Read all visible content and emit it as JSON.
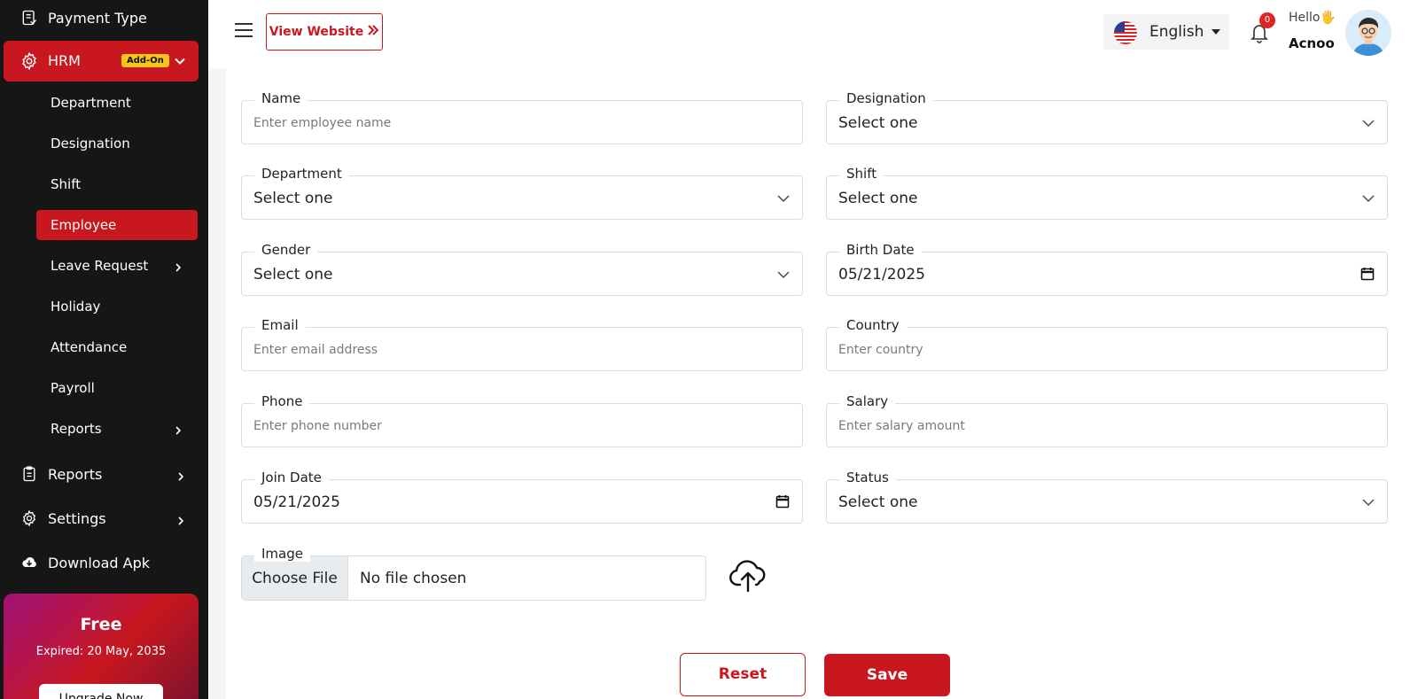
{
  "sidebar": {
    "top_item": "Payment Type",
    "hrm_label": "HRM",
    "hrm_badge": "Add-On",
    "sub_items": [
      {
        "label": "Department"
      },
      {
        "label": "Designation"
      },
      {
        "label": "Shift"
      },
      {
        "label": "Employee"
      },
      {
        "label": "Leave Request"
      },
      {
        "label": "Holiday"
      },
      {
        "label": "Attendance"
      },
      {
        "label": "Payroll"
      },
      {
        "label": "Reports"
      }
    ],
    "bottom_items": [
      {
        "label": "Reports"
      },
      {
        "label": "Settings"
      },
      {
        "label": "Download Apk"
      }
    ],
    "promo": {
      "plan": "Free",
      "expires": "Expired: 20 May, 2035",
      "button": "Upgrade Now"
    }
  },
  "header": {
    "view_website": "View Website",
    "language": "English",
    "notification_count": "0",
    "greeting": "Hello",
    "greeting_emoji": "🖐",
    "user_name": "Acnoo"
  },
  "form": {
    "name": {
      "label": "Name",
      "placeholder": "Enter employee name"
    },
    "designation": {
      "label": "Designation",
      "value": "Select one"
    },
    "department": {
      "label": "Department",
      "value": "Select one"
    },
    "shift": {
      "label": "Shift",
      "value": "Select one"
    },
    "gender": {
      "label": "Gender",
      "value": "Select one"
    },
    "birth_date": {
      "label": "Birth Date",
      "value": "05/21/2025"
    },
    "email": {
      "label": "Email",
      "placeholder": "Enter email address"
    },
    "country": {
      "label": "Country",
      "placeholder": "Enter country"
    },
    "phone": {
      "label": "Phone",
      "placeholder": "Enter phone number"
    },
    "salary": {
      "label": "Salary",
      "placeholder": "Enter salary amount"
    },
    "join_date": {
      "label": "Join Date",
      "value": "05/21/2025"
    },
    "status": {
      "label": "Status",
      "value": "Select one"
    },
    "image": {
      "label": "Image",
      "button": "Choose File",
      "status": "No file chosen"
    },
    "reset": "Reset",
    "save": "Save"
  },
  "colors": {
    "accent": "#c8171e",
    "sidebar_bg": "#161616",
    "badge": "#f7c41a"
  }
}
